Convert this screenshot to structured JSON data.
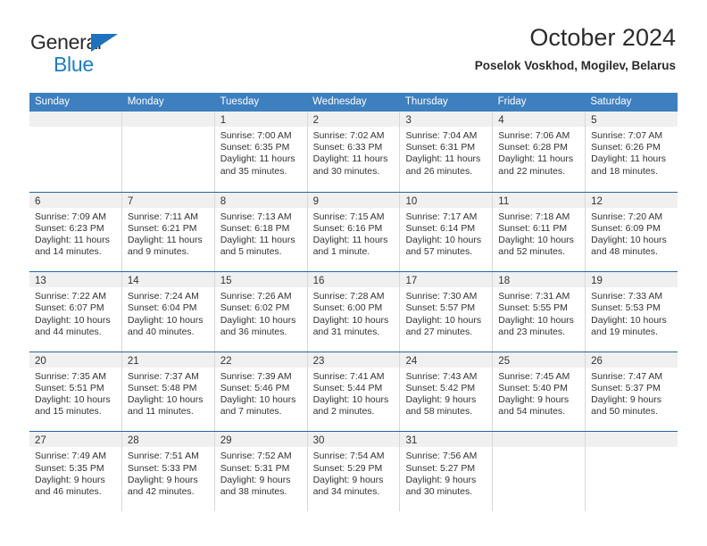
{
  "brand": {
    "line1": "General",
    "line2": "Blue",
    "triangle_icon": "triangle-logo-icon",
    "accent_color": "#1f7cc4"
  },
  "header": {
    "title": "October 2024",
    "subtitle": "Poselok Voskhod, Mogilev, Belarus"
  },
  "colors": {
    "header_blue": "#3d7fbf",
    "row_divider_blue": "#27659f",
    "day_band_gray": "#f0f0f0",
    "text": "#333333"
  },
  "weekdays": [
    "Sunday",
    "Monday",
    "Tuesday",
    "Wednesday",
    "Thursday",
    "Friday",
    "Saturday"
  ],
  "weeks": [
    [
      {
        "day": "",
        "sunrise": "",
        "sunset": "",
        "daylight": "",
        "daylight2": "",
        "empty": true
      },
      {
        "day": "",
        "sunrise": "",
        "sunset": "",
        "daylight": "",
        "daylight2": "",
        "empty": true
      },
      {
        "day": "1",
        "sunrise": "Sunrise: 7:00 AM",
        "sunset": "Sunset: 6:35 PM",
        "daylight": "Daylight: 11 hours",
        "daylight2": "and 35 minutes."
      },
      {
        "day": "2",
        "sunrise": "Sunrise: 7:02 AM",
        "sunset": "Sunset: 6:33 PM",
        "daylight": "Daylight: 11 hours",
        "daylight2": "and 30 minutes."
      },
      {
        "day": "3",
        "sunrise": "Sunrise: 7:04 AM",
        "sunset": "Sunset: 6:31 PM",
        "daylight": "Daylight: 11 hours",
        "daylight2": "and 26 minutes."
      },
      {
        "day": "4",
        "sunrise": "Sunrise: 7:06 AM",
        "sunset": "Sunset: 6:28 PM",
        "daylight": "Daylight: 11 hours",
        "daylight2": "and 22 minutes."
      },
      {
        "day": "5",
        "sunrise": "Sunrise: 7:07 AM",
        "sunset": "Sunset: 6:26 PM",
        "daylight": "Daylight: 11 hours",
        "daylight2": "and 18 minutes."
      }
    ],
    [
      {
        "day": "6",
        "sunrise": "Sunrise: 7:09 AM",
        "sunset": "Sunset: 6:23 PM",
        "daylight": "Daylight: 11 hours",
        "daylight2": "and 14 minutes."
      },
      {
        "day": "7",
        "sunrise": "Sunrise: 7:11 AM",
        "sunset": "Sunset: 6:21 PM",
        "daylight": "Daylight: 11 hours",
        "daylight2": "and 9 minutes."
      },
      {
        "day": "8",
        "sunrise": "Sunrise: 7:13 AM",
        "sunset": "Sunset: 6:18 PM",
        "daylight": "Daylight: 11 hours",
        "daylight2": "and 5 minutes."
      },
      {
        "day": "9",
        "sunrise": "Sunrise: 7:15 AM",
        "sunset": "Sunset: 6:16 PM",
        "daylight": "Daylight: 11 hours",
        "daylight2": "and 1 minute."
      },
      {
        "day": "10",
        "sunrise": "Sunrise: 7:17 AM",
        "sunset": "Sunset: 6:14 PM",
        "daylight": "Daylight: 10 hours",
        "daylight2": "and 57 minutes."
      },
      {
        "day": "11",
        "sunrise": "Sunrise: 7:18 AM",
        "sunset": "Sunset: 6:11 PM",
        "daylight": "Daylight: 10 hours",
        "daylight2": "and 52 minutes."
      },
      {
        "day": "12",
        "sunrise": "Sunrise: 7:20 AM",
        "sunset": "Sunset: 6:09 PM",
        "daylight": "Daylight: 10 hours",
        "daylight2": "and 48 minutes."
      }
    ],
    [
      {
        "day": "13",
        "sunrise": "Sunrise: 7:22 AM",
        "sunset": "Sunset: 6:07 PM",
        "daylight": "Daylight: 10 hours",
        "daylight2": "and 44 minutes."
      },
      {
        "day": "14",
        "sunrise": "Sunrise: 7:24 AM",
        "sunset": "Sunset: 6:04 PM",
        "daylight": "Daylight: 10 hours",
        "daylight2": "and 40 minutes."
      },
      {
        "day": "15",
        "sunrise": "Sunrise: 7:26 AM",
        "sunset": "Sunset: 6:02 PM",
        "daylight": "Daylight: 10 hours",
        "daylight2": "and 36 minutes."
      },
      {
        "day": "16",
        "sunrise": "Sunrise: 7:28 AM",
        "sunset": "Sunset: 6:00 PM",
        "daylight": "Daylight: 10 hours",
        "daylight2": "and 31 minutes."
      },
      {
        "day": "17",
        "sunrise": "Sunrise: 7:30 AM",
        "sunset": "Sunset: 5:57 PM",
        "daylight": "Daylight: 10 hours",
        "daylight2": "and 27 minutes."
      },
      {
        "day": "18",
        "sunrise": "Sunrise: 7:31 AM",
        "sunset": "Sunset: 5:55 PM",
        "daylight": "Daylight: 10 hours",
        "daylight2": "and 23 minutes."
      },
      {
        "day": "19",
        "sunrise": "Sunrise: 7:33 AM",
        "sunset": "Sunset: 5:53 PM",
        "daylight": "Daylight: 10 hours",
        "daylight2": "and 19 minutes."
      }
    ],
    [
      {
        "day": "20",
        "sunrise": "Sunrise: 7:35 AM",
        "sunset": "Sunset: 5:51 PM",
        "daylight": "Daylight: 10 hours",
        "daylight2": "and 15 minutes."
      },
      {
        "day": "21",
        "sunrise": "Sunrise: 7:37 AM",
        "sunset": "Sunset: 5:48 PM",
        "daylight": "Daylight: 10 hours",
        "daylight2": "and 11 minutes."
      },
      {
        "day": "22",
        "sunrise": "Sunrise: 7:39 AM",
        "sunset": "Sunset: 5:46 PM",
        "daylight": "Daylight: 10 hours",
        "daylight2": "and 7 minutes."
      },
      {
        "day": "23",
        "sunrise": "Sunrise: 7:41 AM",
        "sunset": "Sunset: 5:44 PM",
        "daylight": "Daylight: 10 hours",
        "daylight2": "and 2 minutes."
      },
      {
        "day": "24",
        "sunrise": "Sunrise: 7:43 AM",
        "sunset": "Sunset: 5:42 PM",
        "daylight": "Daylight: 9 hours",
        "daylight2": "and 58 minutes."
      },
      {
        "day": "25",
        "sunrise": "Sunrise: 7:45 AM",
        "sunset": "Sunset: 5:40 PM",
        "daylight": "Daylight: 9 hours",
        "daylight2": "and 54 minutes."
      },
      {
        "day": "26",
        "sunrise": "Sunrise: 7:47 AM",
        "sunset": "Sunset: 5:37 PM",
        "daylight": "Daylight: 9 hours",
        "daylight2": "and 50 minutes."
      }
    ],
    [
      {
        "day": "27",
        "sunrise": "Sunrise: 7:49 AM",
        "sunset": "Sunset: 5:35 PM",
        "daylight": "Daylight: 9 hours",
        "daylight2": "and 46 minutes."
      },
      {
        "day": "28",
        "sunrise": "Sunrise: 7:51 AM",
        "sunset": "Sunset: 5:33 PM",
        "daylight": "Daylight: 9 hours",
        "daylight2": "and 42 minutes."
      },
      {
        "day": "29",
        "sunrise": "Sunrise: 7:52 AM",
        "sunset": "Sunset: 5:31 PM",
        "daylight": "Daylight: 9 hours",
        "daylight2": "and 38 minutes."
      },
      {
        "day": "30",
        "sunrise": "Sunrise: 7:54 AM",
        "sunset": "Sunset: 5:29 PM",
        "daylight": "Daylight: 9 hours",
        "daylight2": "and 34 minutes."
      },
      {
        "day": "31",
        "sunrise": "Sunrise: 7:56 AM",
        "sunset": "Sunset: 5:27 PM",
        "daylight": "Daylight: 9 hours",
        "daylight2": "and 30 minutes."
      },
      {
        "day": "",
        "sunrise": "",
        "sunset": "",
        "daylight": "",
        "daylight2": "",
        "empty": true
      },
      {
        "day": "",
        "sunrise": "",
        "sunset": "",
        "daylight": "",
        "daylight2": "",
        "empty": true
      }
    ]
  ]
}
